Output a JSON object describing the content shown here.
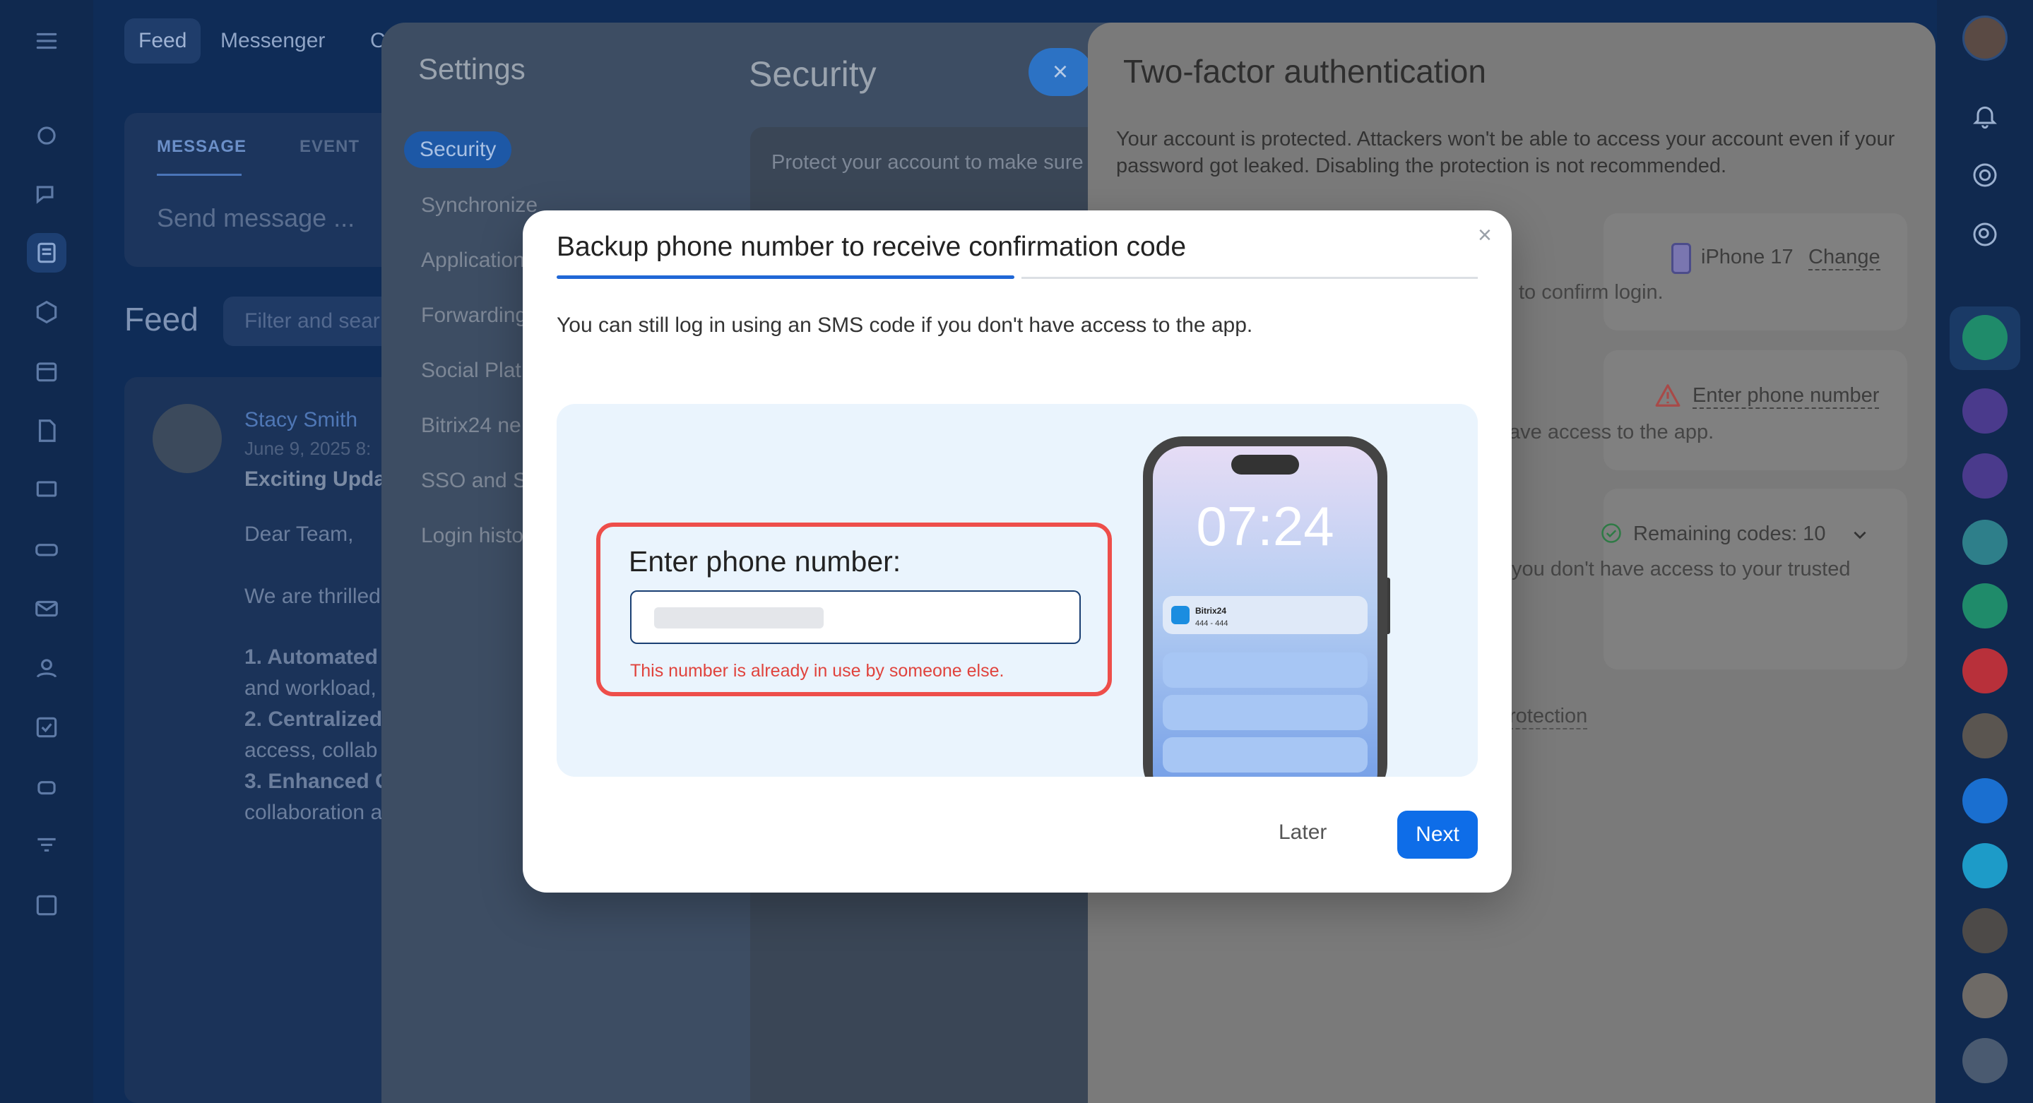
{
  "topbar": {
    "tabs": [
      "Feed",
      "Messenger",
      "C"
    ]
  },
  "composer": {
    "tabs": [
      "MESSAGE",
      "EVENT"
    ],
    "placeholder": "Send message ..."
  },
  "feed": {
    "title": "Feed",
    "filter_placeholder": "Filter and sear"
  },
  "post": {
    "author": "Stacy Smith",
    "date": "June 9, 2025 8:",
    "title": "Exciting Upda",
    "lines": [
      "Dear Team,",
      "We are thrilled",
      "1. Automated",
      "and workload,",
      "2. Centralized",
      "access, collab",
      "3. Enhanced C",
      "collaboration a"
    ]
  },
  "settings": {
    "title": "Settings",
    "menu": [
      "Security",
      "Synchronize",
      "Application",
      "Forwarding",
      "Social Plat",
      "Bitrix24 ne",
      "SSO and S",
      "Login histo"
    ],
    "section_title": "Security",
    "section_desc": "Protect your account to make sure",
    "close_glyph": "×"
  },
  "twofa": {
    "title": "Two-factor authentication",
    "desc": "Your account is protected. Attackers won't be able to access your account even if your password got leaked. Disabling the protection is not recommended.",
    "device_name": "iPhone 17",
    "change_label": "Change",
    "confirm_login": "to confirm login.",
    "enter_phone_link": "Enter phone number",
    "access_text": "ave access to the app.",
    "remaining_codes": "Remaining codes: 10",
    "trusted_text": "you don't have access to your trusted",
    "protection_link": "rotection"
  },
  "modal": {
    "title": "Backup phone number to receive confirmation code",
    "close_glyph": "×",
    "description": "You can still log in using an SMS code if you don't have access to the app.",
    "phone_label": "Enter phone number:",
    "error": "This number is already in use by someone else.",
    "phone_time": "07:24",
    "notif_app": "Bitrix24",
    "notif_text": "444 - 444",
    "later_label": "Later",
    "next_label": "Next"
  },
  "colors": {
    "accent": "#0e6de8",
    "error": "#e0433d",
    "nav_bg": "#10294f",
    "overlay": "#7a7a7a"
  }
}
